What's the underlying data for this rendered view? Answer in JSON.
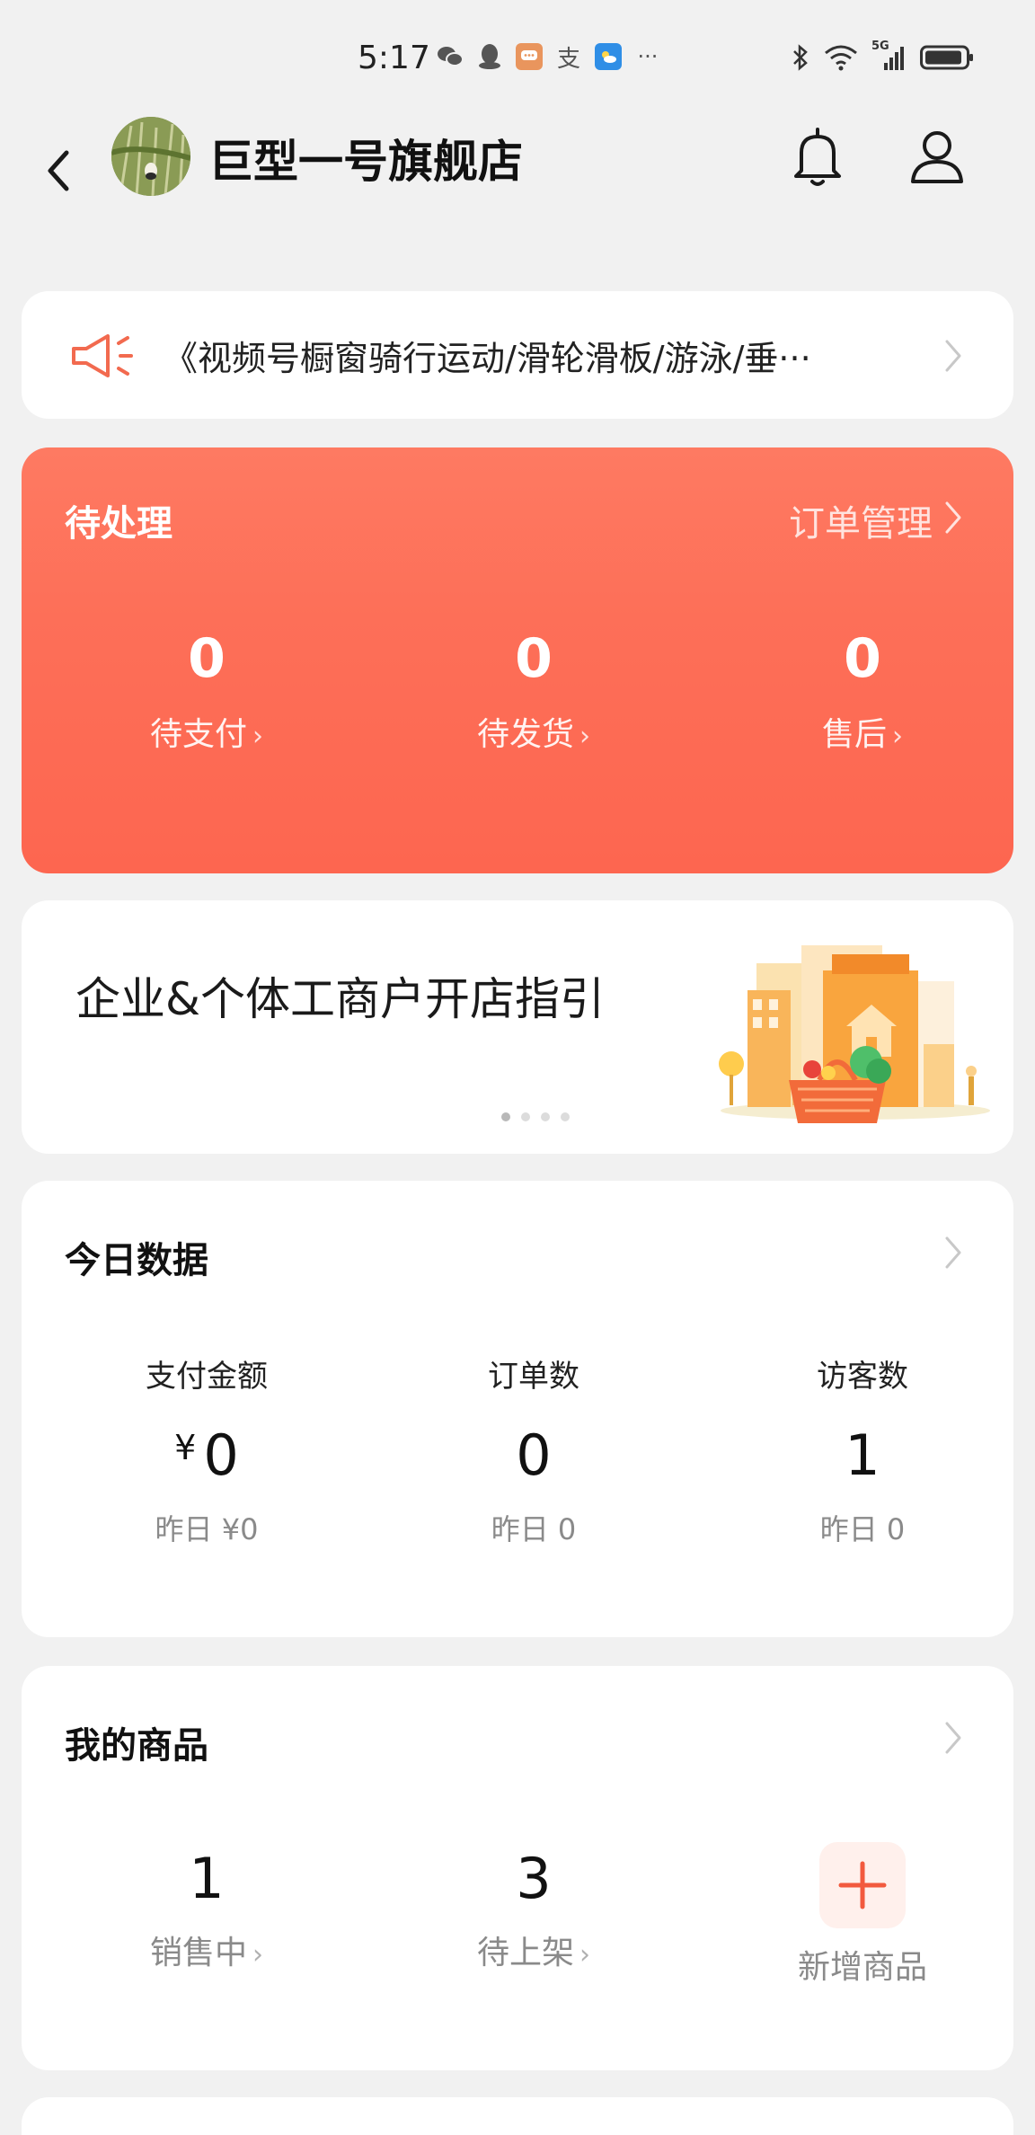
{
  "status_bar": {
    "time": "5:17",
    "app_icons": [
      "wechat-icon",
      "qq-icon",
      "message-icon",
      "alipay-icon",
      "weather-icon",
      "more-icon"
    ],
    "more_glyph": "···",
    "alipay_glyph": "支",
    "network": "5G"
  },
  "header": {
    "shop_name": "巨型一号旗舰店"
  },
  "notice": {
    "text": "《视频号橱窗骑行运动/滑轮滑板/游泳/垂···"
  },
  "pending": {
    "title": "待处理",
    "link": "订单管理",
    "items": [
      {
        "count": "0",
        "label": "待支付"
      },
      {
        "count": "0",
        "label": "待发货"
      },
      {
        "count": "0",
        "label": "售后"
      }
    ]
  },
  "guide": {
    "text": "企业&个体工商户开店指引",
    "pages": 4,
    "active_page": 0
  },
  "today": {
    "title": "今日数据",
    "items": [
      {
        "label": "支付金额",
        "currency": "¥",
        "value": "0",
        "yesterday": "昨日 ¥0"
      },
      {
        "label": "订单数",
        "value": "0",
        "yesterday": "昨日 0"
      },
      {
        "label": "访客数",
        "value": "1",
        "yesterday": "昨日 0"
      }
    ]
  },
  "products": {
    "title": "我的商品",
    "items": [
      {
        "value": "1",
        "label": "销售中"
      },
      {
        "value": "3",
        "label": "待上架"
      }
    ],
    "add_label": "新增商品"
  },
  "colors": {
    "accent": "#fd6c55",
    "background": "#f1f1f1",
    "card": "#ffffff"
  }
}
